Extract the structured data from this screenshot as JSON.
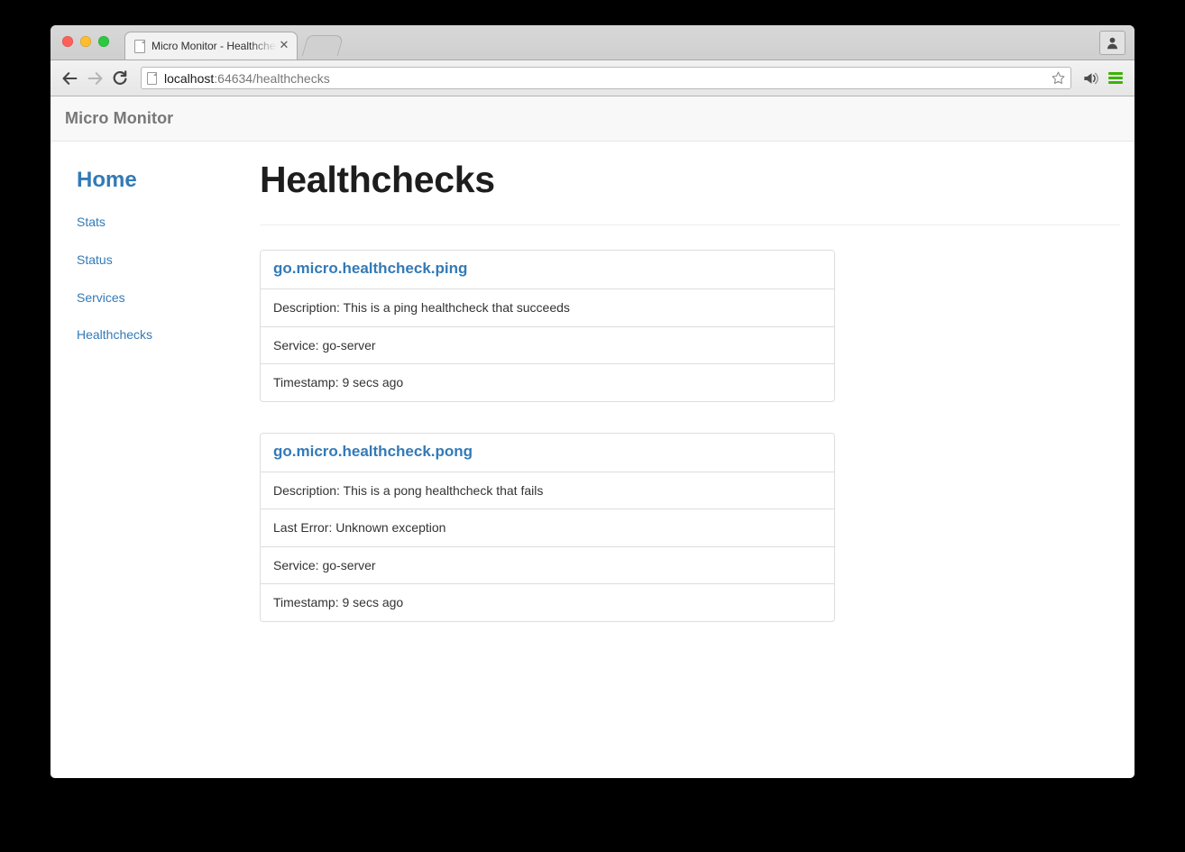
{
  "browser": {
    "tab": {
      "title": "Micro Monitor - Healthchec",
      "close_label": "✕",
      "favicon_name": "page-favicon"
    },
    "new_tab_label": "",
    "toolbar": {
      "back_label": "",
      "forward_label": "",
      "reload_label": "",
      "url_host": "localhost",
      "url_rest": ":64634/healthchecks",
      "star_label": "",
      "cast_label": "",
      "menu_label": "",
      "profile_label": ""
    }
  },
  "navbar": {
    "brand": "Micro Monitor"
  },
  "sidebar": {
    "home": "Home",
    "items": [
      {
        "label": "Stats"
      },
      {
        "label": "Status"
      },
      {
        "label": "Services"
      },
      {
        "label": "Healthchecks"
      }
    ]
  },
  "main": {
    "title": "Healthchecks",
    "panels": [
      {
        "name": "go.micro.healthcheck.ping",
        "rows": [
          "Description: This is a ping healthcheck that succeeds",
          "Service: go-server",
          "Timestamp: 9 secs ago"
        ]
      },
      {
        "name": "go.micro.healthcheck.pong",
        "rows": [
          "Description: This is a pong healthcheck that fails",
          "Last Error: Unknown exception",
          "Service: go-server",
          "Timestamp: 9 secs ago"
        ]
      }
    ]
  },
  "colors": {
    "link": "#337ab7",
    "panel_border": "#dddddd",
    "navbar_bg": "#f8f8f8",
    "text": "#333333",
    "menu_green": "#3bb300"
  }
}
